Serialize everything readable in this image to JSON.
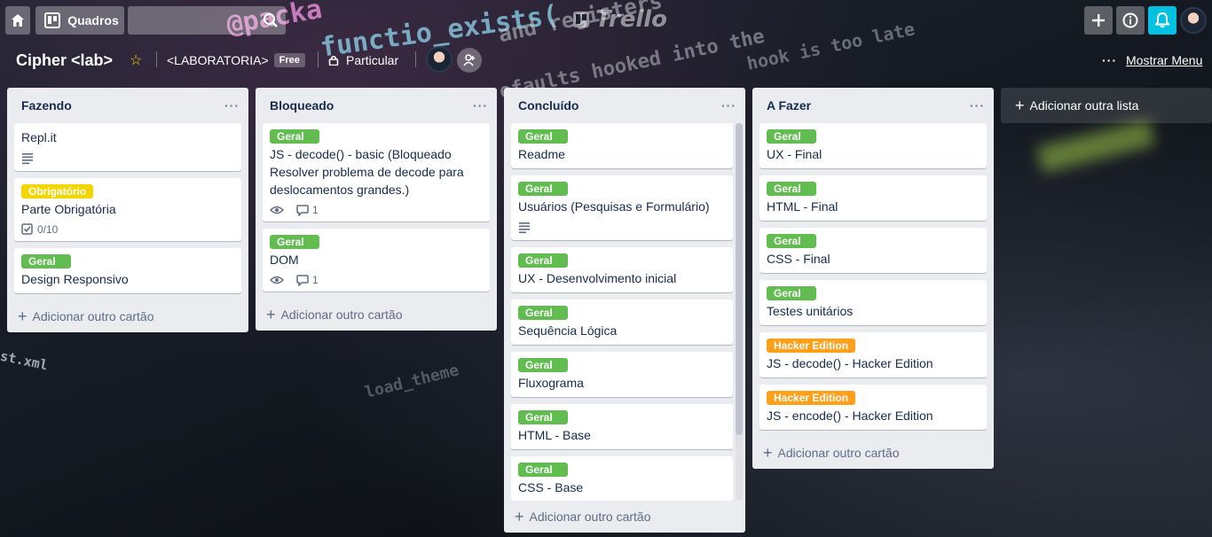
{
  "topbar": {
    "boards_label": "Quadros",
    "search_value": "",
    "logo_text": "Trello"
  },
  "board": {
    "name": "Cipher <lab>",
    "team": "<LABORATORIA>",
    "plan_badge": "Free",
    "visibility": "Particular",
    "menu_label": "Mostrar Menu"
  },
  "lists": [
    {
      "title": "Fazendo",
      "add_card": "Adicionar outro cartão",
      "cards": [
        {
          "title": "Repl.it"
        },
        {
          "label": "Obrigatório",
          "title": "Parte Obrigatória",
          "checklist": "0/10"
        },
        {
          "label": "Geral",
          "title": "Design Responsivo"
        }
      ]
    },
    {
      "title": "Bloqueado",
      "add_card": "Adicionar outro cartão",
      "cards": [
        {
          "label": "Geral",
          "title": "JS - decode() - basic (Bloqueado Resolver problema de decode para deslocamentos grandes.)",
          "comments": "1"
        },
        {
          "label": "Geral",
          "title": "DOM",
          "comments": "1"
        }
      ]
    },
    {
      "title": "Concluído",
      "add_card": "Adicionar outro cartão",
      "cards": [
        {
          "label": "Geral",
          "title": "Readme"
        },
        {
          "label": "Geral",
          "title": "Usuários (Pesquisas e Formulário)"
        },
        {
          "label": "Geral",
          "title": "UX - Desenvolvimento inicial"
        },
        {
          "label": "Geral",
          "title": "Sequência Lógica"
        },
        {
          "label": "Geral",
          "title": "Fluxograma"
        },
        {
          "label": "Geral",
          "title": "HTML - Base"
        },
        {
          "label": "Geral",
          "title": "CSS - Base"
        }
      ]
    },
    {
      "title": "A Fazer",
      "add_card": "Adicionar outro cartão",
      "cards": [
        {
          "label": "Geral",
          "title": "UX - Final"
        },
        {
          "label": "Geral",
          "title": "HTML - Final"
        },
        {
          "label": "Geral",
          "title": "CSS - Final"
        },
        {
          "label": "Geral",
          "title": "Testes unitários"
        },
        {
          "label": "Hacker Edition",
          "title": "JS - decode() - Hacker Edition"
        },
        {
          "label": "Hacker Edition",
          "title": "JS - encode() - Hacker Edition"
        }
      ]
    }
  ],
  "add_list_label": "Adicionar outra lista",
  "colors": {
    "label_green": "#61bd4f",
    "label_yellow": "#f2d600",
    "label_orange": "#ff9f1a",
    "bell_accent": "#00c2e0",
    "list_bg": "#ebecf0"
  }
}
